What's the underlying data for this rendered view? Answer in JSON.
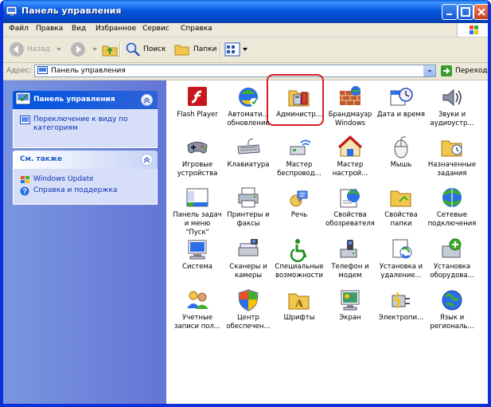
{
  "window": {
    "title": "Панель управления"
  },
  "menu": [
    "Файл",
    "Правка",
    "Вид",
    "Избранное",
    "Сервис",
    "Справка"
  ],
  "toolbar": {
    "back": "Назад",
    "search": "Поиск",
    "folders": "Папки"
  },
  "address": {
    "label": "Адрес:",
    "value": "Панель управления",
    "go": "Переход"
  },
  "sidebar": {
    "control_panel": {
      "title": "Панель управления",
      "switch_link": "Переключение к виду по категориям"
    },
    "see_also": {
      "title": "См. также",
      "links": [
        "Windows Update",
        "Справка и поддержка"
      ]
    }
  },
  "items": [
    {
      "label": "Flash Player",
      "icon": "flash-icon"
    },
    {
      "label": "Автомати...\nобновление",
      "icon": "auto-update-icon"
    },
    {
      "label": "Администр...",
      "icon": "admin-tools-icon"
    },
    {
      "label": "Брандмауэр\nWindows",
      "icon": "firewall-icon"
    },
    {
      "label": "Дата и время",
      "icon": "date-time-icon"
    },
    {
      "label": "Звуки и\nаудиоустр...",
      "icon": "sounds-icon"
    },
    {
      "label": "Игровые\nустройства",
      "icon": "gamepad-icon"
    },
    {
      "label": "Клавиатура",
      "icon": "keyboard-icon"
    },
    {
      "label": "Мастер\nбеспровод...",
      "icon": "wireless-wizard-icon"
    },
    {
      "label": "Мастер\nнастрой...",
      "icon": "network-wizard-icon"
    },
    {
      "label": "Мышь",
      "icon": "mouse-icon"
    },
    {
      "label": "Назначенные\nзадания",
      "icon": "scheduled-tasks-icon"
    },
    {
      "label": "Панель задач\nи меню \"Пуск\"",
      "icon": "taskbar-icon"
    },
    {
      "label": "Принтеры и\nфаксы",
      "icon": "printer-icon"
    },
    {
      "label": "Речь",
      "icon": "speech-icon"
    },
    {
      "label": "Свойства\nобозревателя",
      "icon": "internet-options-icon"
    },
    {
      "label": "Свойства\nпапки",
      "icon": "folder-options-icon"
    },
    {
      "label": "Сетевые\nподключения",
      "icon": "network-connections-icon"
    },
    {
      "label": "Система",
      "icon": "system-icon"
    },
    {
      "label": "Сканеры и\nкамеры",
      "icon": "scanner-icon"
    },
    {
      "label": "Специальные\nвозможности",
      "icon": "accessibility-icon"
    },
    {
      "label": "Телефон и\nмодем",
      "icon": "phone-modem-icon"
    },
    {
      "label": "Установка и\nудаление...",
      "icon": "add-remove-icon"
    },
    {
      "label": "Установка\nоборудова...",
      "icon": "add-hardware-icon"
    },
    {
      "label": "Учетные\nзаписи пол...",
      "icon": "user-accounts-icon"
    },
    {
      "label": "Центр\nобеспечен...",
      "icon": "security-center-icon"
    },
    {
      "label": "Шрифты",
      "icon": "fonts-icon"
    },
    {
      "label": "Экран",
      "icon": "display-icon"
    },
    {
      "label": "Электропи...",
      "icon": "power-icon"
    },
    {
      "label": "Язык и\nрегиональ...",
      "icon": "regional-icon"
    }
  ],
  "highlighted_item": "Администр...",
  "colors": {
    "title_bar": "#0a5fd6",
    "sidebar": "#7a96df",
    "highlight": "#d42020"
  }
}
